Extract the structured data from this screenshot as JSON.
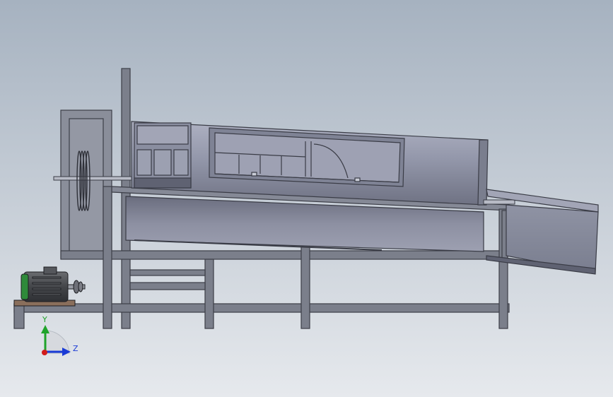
{
  "viewport": {
    "background_top": "#a6b2c0",
    "background_bottom": "#e6e9ed"
  },
  "model": {
    "frame_color": "#7b7f8b",
    "frame_dark": "#3c3e47",
    "drum_color": "#9094a6",
    "drum_dark": "#5c5f70",
    "motor_color": "#4b4e52",
    "motor_accent": "#2f8a3a",
    "base_plate_color": "#8a6f5c"
  },
  "triad": {
    "y_label": "Y",
    "z_label": "Z",
    "y_color": "#1fa32a",
    "z_color": "#1a3bd6",
    "x_color": "#d11b1b"
  }
}
